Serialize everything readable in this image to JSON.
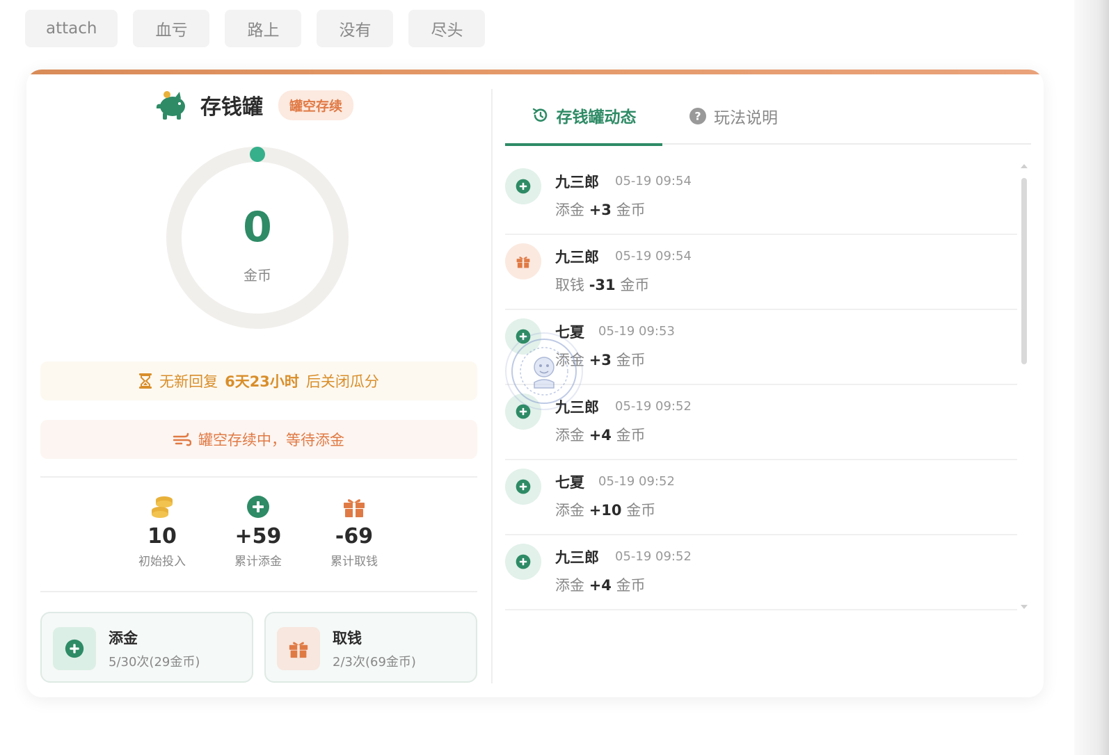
{
  "tags": [
    "attach",
    "血亏",
    "路上",
    "没有",
    "尽头"
  ],
  "left": {
    "title": "存钱罐",
    "badge": "罐空存续",
    "ring": {
      "value": "0",
      "unit": "金币"
    },
    "notice_countdown": {
      "prefix": "无新回复",
      "highlight": "6天23小时",
      "suffix": "后关闭瓜分"
    },
    "notice_status": "罐空存续中，等待添金",
    "stats": [
      {
        "icon": "coins-icon",
        "value": "10",
        "label": "初始投入"
      },
      {
        "icon": "plus-circle-icon",
        "value": "+59",
        "label": "累计添金"
      },
      {
        "icon": "gift-icon",
        "value": "-69",
        "label": "累计取钱"
      }
    ],
    "actions": {
      "add": {
        "title": "添金",
        "sub": "5/30次(29金币)"
      },
      "withdraw": {
        "title": "取钱",
        "sub": "2/3次(69金币)"
      }
    }
  },
  "right": {
    "tabs": {
      "activity": "存钱罐动态",
      "help": "玩法说明"
    },
    "feed": [
      {
        "name": "九三郎",
        "time": "05-19 09:54",
        "action": "添金",
        "amount": "+3",
        "unit": "金币",
        "type": "add"
      },
      {
        "name": "九三郎",
        "time": "05-19 09:54",
        "action": "取钱",
        "amount": "-31",
        "unit": "金币",
        "type": "withdraw"
      },
      {
        "name": "七夏",
        "time": "05-19 09:53",
        "action": "添金",
        "amount": "+3",
        "unit": "金币",
        "type": "add"
      },
      {
        "name": "九三郎",
        "time": "05-19 09:52",
        "action": "添金",
        "amount": "+4",
        "unit": "金币",
        "type": "add"
      },
      {
        "name": "七夏",
        "time": "05-19 09:52",
        "action": "添金",
        "amount": "+10",
        "unit": "金币",
        "type": "add"
      },
      {
        "name": "九三郎",
        "time": "05-19 09:52",
        "action": "添金",
        "amount": "+4",
        "unit": "金币",
        "type": "add"
      }
    ]
  },
  "colors": {
    "green": "#2e8b66",
    "orange": "#e07a45",
    "amber": "#d98e2a",
    "gold": "#e8b13a"
  }
}
